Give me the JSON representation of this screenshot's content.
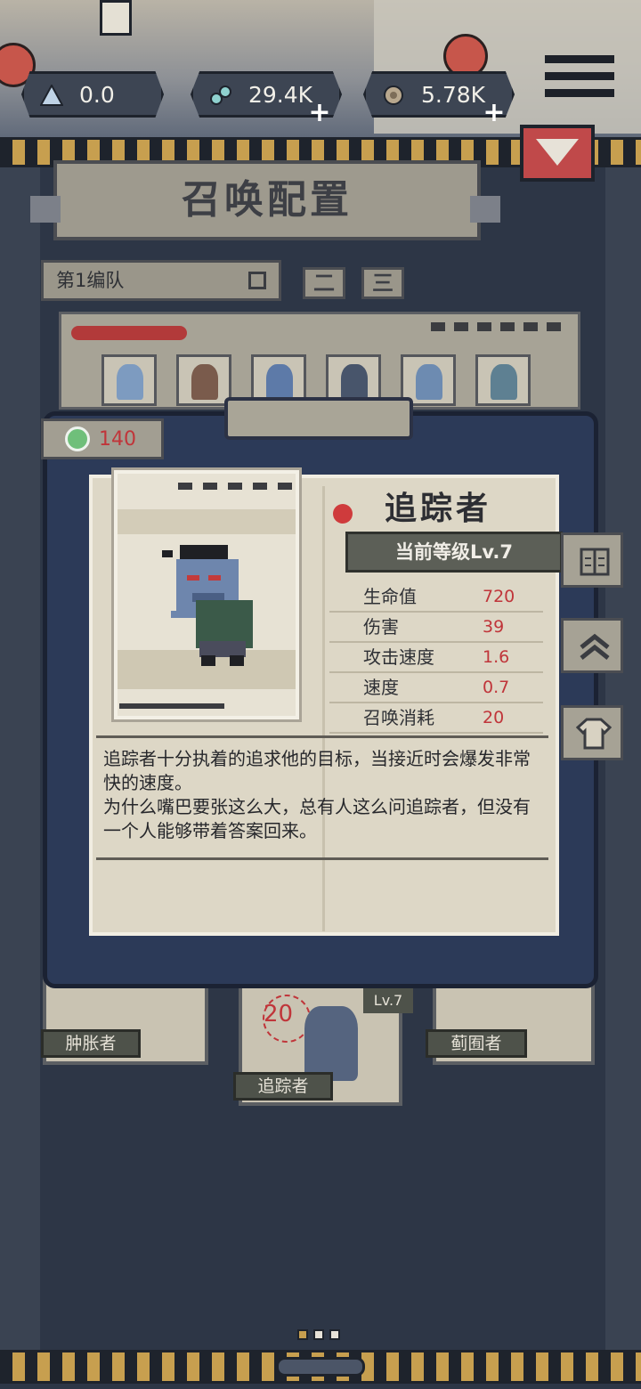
{
  "resources": [
    {
      "name": "triangle-resource",
      "value": "0.0",
      "icon": "triangle-icon"
    },
    {
      "name": "gem-resource",
      "value": "29.4K",
      "icon": "gem-icon"
    },
    {
      "name": "coin-resource",
      "value": "5.78K",
      "icon": "coin-icon"
    }
  ],
  "page_title": "召唤配置",
  "team": {
    "name": "第1编队",
    "tabs": [
      "二",
      "三"
    ]
  },
  "cost_value": "140",
  "character": {
    "name": "追踪者",
    "level": "当前等级Lv.7",
    "stats": [
      {
        "label": "生命值",
        "value": "720"
      },
      {
        "label": "伤害",
        "value": "39"
      },
      {
        "label": "攻击速度",
        "value": "1.6"
      },
      {
        "label": "速度",
        "value": "0.7"
      },
      {
        "label": "召唤消耗",
        "value": "20"
      }
    ],
    "description_line1": "追踪者十分执着的追求他的目标，当接近时会爆发非常快的速度。",
    "description_line2": "为什么嘴巴要张这么大，总有人这么问追踪者，但没有一个人能够带着答案回来。"
  },
  "side_buttons": {
    "book": "book-icon",
    "upgrade": "chevron-up-icon",
    "shirt": "shirt-icon"
  },
  "lower_cards": [
    {
      "label": "肿胀者"
    },
    {
      "label": "追踪者",
      "cost": "20",
      "level": "Lv.7"
    },
    {
      "label": "蓟囿者"
    }
  ],
  "colors": {
    "accent_red": "#c0353a",
    "stripe_gold": "#c79f4f",
    "modal_blue": "#2c3a58"
  }
}
